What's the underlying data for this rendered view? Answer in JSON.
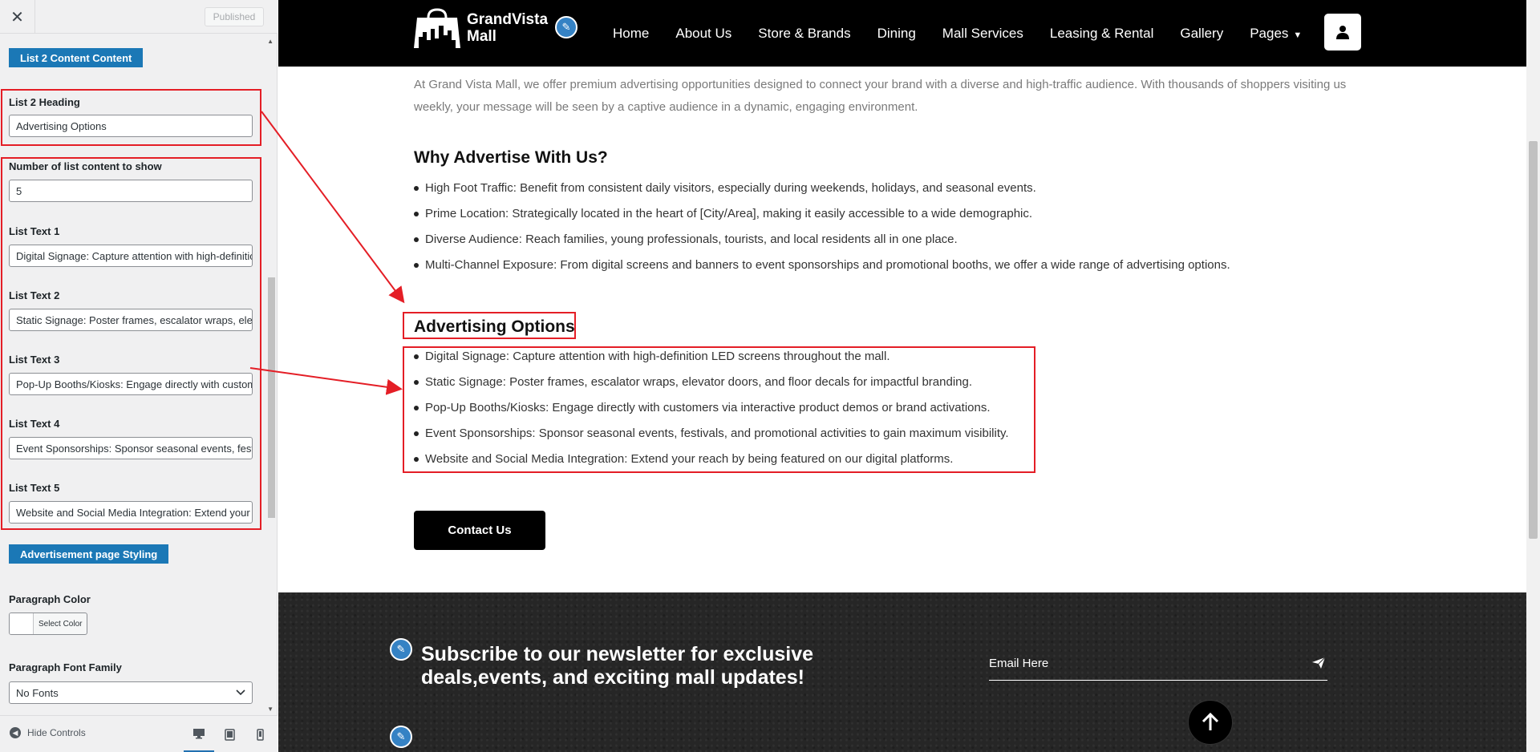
{
  "sidebar": {
    "close_icon": "close-icon",
    "publish_label": "Published",
    "section1_label": "List 2 Content Content",
    "heading_label": "List 2 Heading",
    "heading_value": "Advertising Options",
    "count_label": "Number of list content to show",
    "count_value": "5",
    "list_fields": [
      {
        "label": "List Text 1",
        "value": "Digital Signage: Capture attention with high-definition LED screens throughout the mall."
      },
      {
        "label": "List Text 2",
        "value": "Static Signage: Poster frames, escalator wraps, elevator doors, and floor decals for impactful branding."
      },
      {
        "label": "List Text 3",
        "value": "Pop-Up Booths/Kiosks: Engage directly with customers via interactive product demos or brand activations."
      },
      {
        "label": "List Text 4",
        "value": "Event Sponsorships: Sponsor seasonal events, festivals, and promotional activities to gain maximum visibility."
      },
      {
        "label": "List Text 5",
        "value": "Website and Social Media Integration: Extend your reach by being featured on our digital platforms."
      }
    ],
    "section2_label": "Advertisement page Styling",
    "paragraph_color_label": "Paragraph Color",
    "select_color_label": "Select Color",
    "paragraph_font_label": "Paragraph Font Family",
    "paragraph_font_value": "No Fonts",
    "hide_controls_label": "Hide Controls"
  },
  "site": {
    "logo_line1": "GrandVista",
    "logo_line2": "Mall",
    "nav": [
      "Home",
      "About Us",
      "Store & Brands",
      "Dining",
      "Mall Services",
      "Leasing & Rental",
      "Gallery",
      "Pages"
    ],
    "intro": "At Grand Vista Mall, we offer premium advertising opportunities designed to connect your brand with a diverse and high-traffic audience. With thousands of shoppers visiting us weekly, your message will be seen by a captive audience in a dynamic, engaging environment.",
    "why_heading": "Why Advertise With Us?",
    "why_list": [
      "High Foot Traffic: Benefit from consistent daily visitors, especially during weekends, holidays, and seasonal events.",
      "Prime Location: Strategically located in the heart of [City/Area], making it easily accessible to a wide demographic.",
      "Diverse Audience: Reach families, young professionals, tourists, and local residents all in one place.",
      "Multi-Channel Exposure: From digital screens and banners to event sponsorships and promotional booths, we offer a wide range of advertising options."
    ],
    "options_heading": "Advertising Options",
    "options_list": [
      "Digital Signage: Capture attention with high-definition LED screens throughout the mall.",
      "Static Signage: Poster frames, escalator wraps, elevator doors, and floor decals for impactful branding.",
      "Pop-Up Booths/Kiosks: Engage directly with customers via interactive product demos or brand activations.",
      "Event Sponsorships: Sponsor seasonal events, festivals, and promotional activities to gain maximum visibility.",
      "Website and Social Media Integration: Extend your reach by being featured on our digital platforms."
    ],
    "contact_label": "Contact Us",
    "newsletter_title": "Subscribe to our newsletter for exclusive deals,events, and exciting mall updates!",
    "email_placeholder": "Email Here"
  },
  "colors": {
    "accent": "#1b78b6",
    "annotation": "#e41e26",
    "topbar": "#000000"
  }
}
